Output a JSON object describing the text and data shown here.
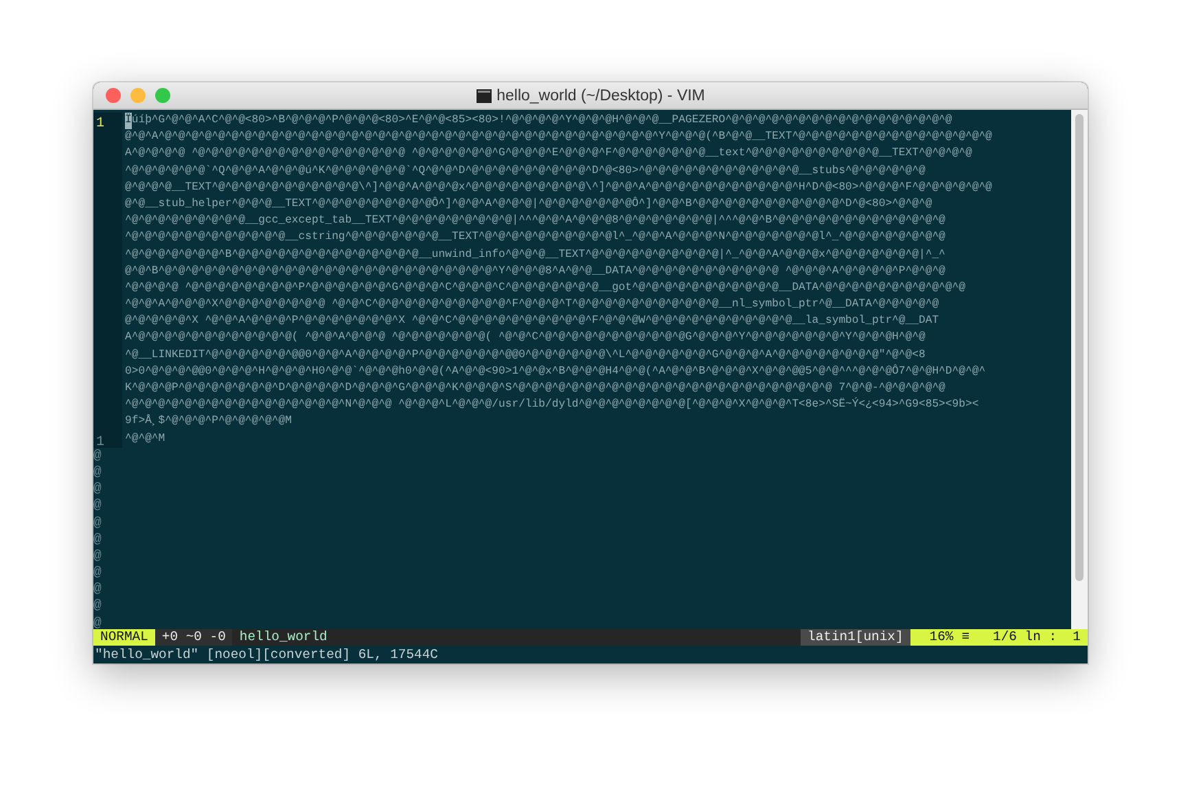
{
  "window": {
    "title": "hello_world (~/Desktop) - VIM"
  },
  "buffer_lines": [
    {
      "number": "1",
      "current": true,
      "cursor_char": "Ï",
      "rows": [
        "úíþ^G^@^@^A^C^@^@<80>^B^@^@^@^P^@^@^@<80>^E^@^@<85><80>!^@^@^@^@^Y^@^@^@H^@^@^@__PAGEZERO^@^@^@^@^@^@^@^@^@^@^@^@^@^@^@^@^@",
        "@^@^A^@^@^@^@^@^@^@^@^@^@^@^@^@^@^@^@^@^@^@^@^@^@^@^@^@^@^@^@^@^@^@^@^@^@^@^@^@^Y^@^@^@(^B^@^@__TEXT^@^@^@^@^@^@^@^@^@^@^@^@^@^@^@",
        "A^@^@^@^@ ^@^@^@^@^@^@^@^@^@^@^@^@^@^@^@^@ ^@^@^@^@^@^@^G^@^@^@^E^@^@^@^F^@^@^@^@^@^@^@__text^@^@^@^@^@^@^@^@^@^@__TEXT^@^@^@^@",
        "^@^@^@^@^@^@`^Q^@^@^A^@^@^@ú^K^@^@^@^@^@^@`^Q^@^@^D^@^@^@^@^@^@^@^@^@^D^@<80>^@^@^@^@^@^@^@^@^@^@^@^@__stubs^@^@^@^@^@^@",
        "@^@^@^@__TEXT^@^@^@^@^@^@^@^@^@^@^@\\^]^@^@^A^@^@^@x^@^@^@^@^@^@^@^@^@\\^]^@^@^A^@^@^@^@^@^@^@^@^@^@^@^H^D^@<80>^@^@^@^F^@^@^@^@^@^@",
        "@^@__stub_helper^@^@^@__TEXT^@^@^@^@^@^@^@^@^@Ô^]^@^@^A^@^@^@|^@^@^@^@^@^@^@Ô^]^@^@^B^@^@^@^@^@^@^@^@^@^@^@^D^@<80>^@^@^@",
        "^@^@^@^@^@^@^@^@^@__gcc_except_tab__TEXT^@^@^@^@^@^@^@^@^@|^^^@^@^A^@^@^@8^@^@^@^@^@^@^@|^^^@^@^B^@^@^@^@^@^@^@^@^@^@^@^@^@",
        "^@^@^@^@^@^@^@^@^@^@^@^@__cstring^@^@^@^@^@^@^@__TEXT^@^@^@^@^@^@^@^@^@^@l^_^@^@^A^@^@^@^N^@^@^@^@^@^@^@l^_^@^@^@^@^@^@^@^@",
        "^@^@^@^@^@^@^@^B^@^@^@^@^@^@^@^@^@^@^@^@^@^@__unwind_info^@^@^@__TEXT^@^@^@^@^@^@^@^@^@^@|^_^@^@^A^@^@^@x^@^@^@^@^@^@^@|^_^",
        "@^@^B^@^@^@^@^@^@^@^@^@^@^@^@^@^@^@^@^@^@^@^@^@^@^@^@^@^Y^@^@^@8^A^@^@__DATA^@^@^@^@^@^@^@^@^@^@^@ ^@^@^@^A^@^@^@^@^P^@^@^@",
        "^@^@^@^@ ^@^@^@^@^@^@^@^@^P^@^@^@^@^@^@^G^@^@^@^C^@^@^@^C^@^@^@^@^@^@^@__got^@^@^@^@^@^@^@^@^@^@^@__DATA^@^@^@^@^@^@^@^@^@^@^@",
        "^@^@^A^@^@^@^X^@^@^@^@^@^@^@^@ ^@^@^C^@^@^@^@^@^@^@^@^@^@^F^@^@^@^T^@^@^@^@^@^@^@^@^@^@^@__nl_symbol_ptr^@__DATA^@^@^@^@^@",
        "@^@^@^@^@^X ^@^@^A^@^@^@^P^@^@^@^@^@^@^@^X ^@^@^C^@^@^@^@^@^@^@^@^@^@^F^@^@^@W^@^@^@^@^@^@^@^@^@^@^@__la_symbol_ptr^@__DAT",
        "A^@^@^@^@^@^@^@^@^@^@^@^@( ^@^@^A^@^@^@ ^@^@^@^@^@^@^@( ^@^@^C^@^@^@^@^@^@^@^@^@^@^@G^@^@^@^Y^@^@^@^@^@^@^@^Y^@^@^@H^@^@",
        "^@__LINKEDIT^@^@^@^@^@^@^@@0^@^@^A^@^@^@^@^P^@^@^@^@^@^@^@@0^@^@^@^@^@^@\\^L^@^@^@^@^@^@^G^@^@^@^A^@^@^@^@^@^@^@^@\"^@^@<8",
        "0>0^@^@^@^@@0^@^@^@^H^@^@^@^H0^@^@`^@^@^@h0^@^@(^A^@^@<90>1^@^@x^B^@^@^@H4^@^@(^A^@^@^B^@^@^@^X^@^@^@@5^@^@^^^@^@^@Ô7^@^@H^D^@^@^",
        "K^@^@^@P^@^@^@^@^@^@^@^D^@^@^@^@^D^@^@^@^G^@^@^@^K^@^@^@^S^@^@^@^@^@^@^@^@^@^@^@^@^@^@^@^@^@^@^@^@^@^@^@^@ 7^@^@-^@^@^@^@^@",
        "^@^@^@^@^@^@^@^@^@^@^@^@^@^@^@^@^N^@^@^@ ^@^@^@^L^@^@^@/usr/lib/dyld^@^@^@^@^@^@^@^@[^@^@^@^X^@^@^@^T<8e>^SË~Ý<¿<94>^G9<85><9b><",
        "9f>Å¸$^@^@^@^P^@^@^@^@^@M"
      ]
    },
    {
      "number": "1",
      "current": false,
      "rows": [
        "^@^@^M"
      ]
    }
  ],
  "filler_rows": [
    "@",
    "@",
    "@",
    "@",
    "@",
    "@",
    "@",
    "@",
    "@",
    "@",
    "@"
  ],
  "status_line": {
    "mode": "NORMAL",
    "changes": "+0 ~0 -0",
    "filename": "hello_world",
    "encoding": "latin1[unix]",
    "percent": "16%",
    "percent_symbol": "≡",
    "position": "1/6 ln :  1"
  },
  "command_line": "\"hello_world\" [noeol][converted] 6L, 17544C"
}
